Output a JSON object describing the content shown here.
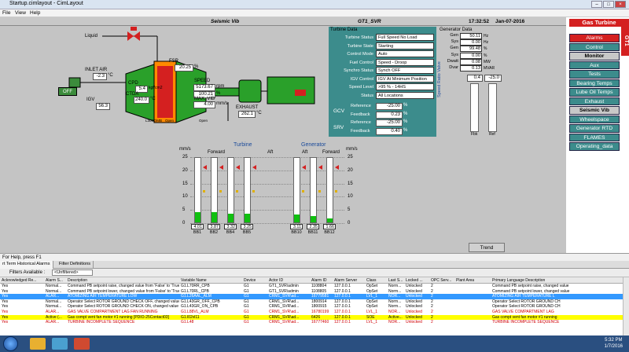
{
  "window": {
    "title": "Startup.cimlayout - CimLayout"
  },
  "menu": [
    "File",
    "View",
    "Help"
  ],
  "header": {
    "screen": "Seismic Vib",
    "unit": "GT1_SVR",
    "time": "17:32:52",
    "date": "Jan-07-2016"
  },
  "process": {
    "liquid": "Liquid",
    "inlet_air": "INLET AIR",
    "inlet_air_val": "-2.3",
    "inlet_air_unit": "°C",
    "off": "OFF",
    "igv": "IGV",
    "igv_val": "56.3",
    "cpd": "CPD",
    "cpd_val": "5.4",
    "cpd_unit": "kgf/cm2",
    "ctda": "CTDA",
    "ctda_val": "240.0",
    "ctda_unit": "°C",
    "fsr": "FSR",
    "fsr_val": "20.25",
    "fsr_unit": "%",
    "speed": "SPEED",
    "speed_val": "5173.67",
    "speed_unit": "rpm",
    "speed_pct": "100.21",
    "speed_pct_unit": "%",
    "max_vib": "MAX. VIB",
    "max_vib_val": "4.00",
    "max_vib_unit": "mm/s",
    "exhaust": "EXHAUST",
    "exhaust_val": "262.1",
    "exhaust_unit": "°C",
    "l30": "L30COMB",
    "l30b": "Open",
    "l30c": "Open"
  },
  "turbine_data": {
    "title": "Turbine Data",
    "rows": [
      {
        "k": "Turbine Status",
        "v": "Full Speed No Load"
      },
      {
        "k": "Turbine State",
        "v": "Starting"
      },
      {
        "k": "Control Mode",
        "v": "Auto"
      },
      {
        "k": "Fuel Control",
        "v": "Speed - Droop"
      },
      {
        "k": "Synchro Status",
        "v": "Synch OFF"
      },
      {
        "k": "IGV Control",
        "v": "IGV At Minimum Position"
      },
      {
        "k": "Speed Level",
        "v": ">95 % - 14HS"
      },
      {
        "k": "Status",
        "v": "All Locations"
      }
    ],
    "gcv": "GCV",
    "srv": "SRV",
    "reference": "Reference",
    "feedback": "Feedback",
    "gcv_ref": "-25.00",
    "gcv_fb": "0.23",
    "srv_ref": "-25.00",
    "srv_fb": "0.40",
    "pct": "%"
  },
  "generator_data": {
    "title": "Generator Data",
    "rows": [
      {
        "k": "Gen",
        "v": "50.11",
        "u": "Hz"
      },
      {
        "k": "Sys",
        "v": "0.00",
        "u": "Hz"
      },
      {
        "k": "Gen",
        "v": "99.48",
        "u": "%"
      },
      {
        "k": "Sys",
        "v": "0.00",
        "u": "%"
      },
      {
        "k": "Dwatt",
        "v": "0.08",
        "u": "MW"
      },
      {
        "k": "Dvar",
        "v": "0.13",
        "u": "MVAR"
      }
    ],
    "srv_title": "Speed Ratio Valve",
    "fbk": "0.4",
    "ref": "-25.0",
    "fbk_lbl": "Fbk",
    "ref_lbl": "Ref"
  },
  "vibration": {
    "turbine": "Turbine",
    "generator": "Generator",
    "forward": "Forward",
    "aft": "Aft",
    "unit": "mm/s",
    "scale": [
      "25",
      "20",
      "15",
      "10",
      "5",
      "0"
    ],
    "bars": [
      {
        "name": "BB1",
        "val": "4.01",
        "level": 0.16
      },
      {
        "name": "BB2",
        "val": "3.87",
        "level": 0.155
      },
      {
        "name": "BB4",
        "val": "3.32",
        "level": 0.13
      },
      {
        "name": "BB5",
        "val": "3.25",
        "level": 0.13
      },
      {
        "name": "BB10",
        "val": "3.11",
        "level": 0.125
      },
      {
        "name": "BB11",
        "val": "2.35",
        "level": 0.095
      },
      {
        "name": "BB12",
        "val": "1.66",
        "level": 0.066
      }
    ]
  },
  "nav": {
    "gas_turbine": "Gas Turbine",
    "gt1": "GT1",
    "items": [
      "Alarms",
      "Control",
      "Monitor",
      "Aux",
      "Tests",
      "Bearing Temps",
      "Lube Oil Temps",
      "Exhaust",
      "Seismic Vib",
      "Wheelspace",
      "Generator RTD",
      "FLAMES",
      "Operating_data"
    ]
  },
  "trend": "Trend",
  "status": "For Help, press F1",
  "alarm_tabs": [
    "rt Term Historical Alarms",
    "Filter Definitions"
  ],
  "toolbar": {
    "filters": "Filters Available :",
    "unfiltered": "<Unfiltered>"
  },
  "alarm_headers": [
    "Acknowledged Re...",
    "Alarm S...",
    "Description",
    "Variable Name",
    "Device",
    "Actor ID",
    "Alarm ID",
    "Alarm Server",
    "Class",
    "Last S...",
    "Locked ...",
    "OPC Serv...",
    "Plant Area",
    "Primary Language Description"
  ],
  "alarms": [
    [
      "Yes",
      "Normal...",
      "Command PB setpoint raise,  changed value from 'False' to 'True'",
      "G1.L70RR_CPB",
      "G1",
      "GT1_SVR\\admin",
      "1108804",
      "127.0.0.1",
      "OpSet",
      "Norm...",
      "Unlocked",
      "2",
      "",
      "Command PB setpoint raise, changed value"
    ],
    [
      "Yes",
      "Normal...",
      "Command PB setpoint lower,  changed value from 'False' to 'True'",
      "G1.L70RL_CPB",
      "G1",
      "GT1_SVR\\admin",
      "1108805",
      "127.0.0.1",
      "OpSet",
      "Norm...",
      "Unlocked",
      "2",
      "",
      "Command PB setpoint lower, changed value"
    ],
    [
      "Yes",
      "ALAR...",
      "ATOMIZING AIR TEMPERATURE LOW",
      "G1.L26AAL_ALM",
      "G1",
      "CRM1_SVR\\ad...",
      "16779581",
      "127.0.0.1",
      "LVL_1",
      "NOR...",
      "Unlocked",
      "2",
      "",
      "ATOMIZING AIR TEMPERATURE L"
    ],
    [
      "Yes",
      "Normal...",
      "Operator Select ROTOR GROUND CHECK OFF,  changed value from 'F",
      "G1.L43GR_OFF_CPB",
      "G1",
      "CRM1_SVR\\ad...",
      "1800914",
      "127.0.0.1",
      "OpSet",
      "Norm...",
      "Unlocked",
      "2",
      "",
      "Operator Select ROTOR GROUND CH"
    ],
    [
      "Yes",
      "Normal...",
      "Operator Select ROTOR GROUND CHECK ON,  changed value from 'Fa",
      "G1.L43GR_ON_CPB",
      "G1",
      "CRM1_SVR\\ad...",
      "1800915",
      "127.0.0.1",
      "OpSet",
      "Norm...",
      "Unlocked",
      "2",
      "",
      "Operator Select ROTOR GROUND CH"
    ],
    [
      "Yes",
      "ALAR...",
      "GAS VALVE COMPARTMENT LAG FAN RUNNING",
      "G1.L88VL_ALM",
      "G1",
      "CRM1_SVR\\ad...",
      "16780199",
      "127.0.0.1",
      "LVL_1",
      "NOR...",
      "Unlocked",
      "2",
      "",
      "GAS VALVE COMPARTMENT LAG"
    ],
    [
      "Yes",
      "Active (...",
      "Gas compt vent fan motor #1 running [PDIO-25Contact03]",
      "G1.l02vl11",
      "G1",
      "CRM1_SVR\\ad...",
      "6426",
      "127.0.0.1",
      "SOE",
      "Active...",
      "Unlocked",
      "2",
      "",
      "Gas compt vent fan motor #1 running"
    ],
    [
      "Yes",
      "ALAR...",
      "TURBINE INCOMPLETE SEQUENCE",
      "G1.L48",
      "G1",
      "CRM1_SVR\\ad...",
      "16777460",
      "127.0.0.1",
      "LVL_1",
      "NOR...",
      "Unlocked",
      "2",
      "",
      "TURBINE INCOMPLETE SEQUENCE"
    ]
  ],
  "alarm_styles": [
    "",
    "",
    "r-blue",
    "",
    "",
    "r-red",
    "r-yellow",
    "r-red"
  ],
  "taskbar": {
    "time": "5:32 PM",
    "date": "1/7/2016"
  }
}
